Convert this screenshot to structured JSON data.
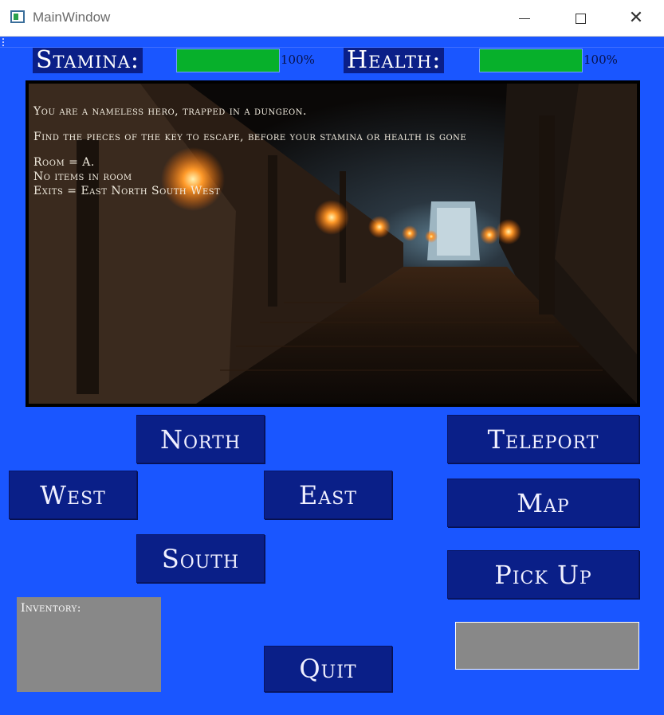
{
  "window": {
    "title": "MainWindow",
    "close_glyph": "✕"
  },
  "stats": {
    "stamina_label": "Stamina:",
    "stamina_pct": "100%",
    "stamina_value": 100,
    "health_label": "Health:",
    "health_pct": "100%",
    "health_value": 100,
    "bar_color": "#07b02b"
  },
  "scene": {
    "line1": "You are a nameless hero, trapped in a dungeon.",
    "line2": "Find the pieces of the key to escape, before your stamina or health is gone",
    "room": "Room = A.",
    "items": "No items in room",
    "exits": "Exits =  East  North  South  West"
  },
  "buttons": {
    "north": "North",
    "west": "West",
    "east": "East",
    "south": "South",
    "teleport": "Teleport",
    "map": "Map",
    "pick_up": "Pick Up",
    "quit": "Quit"
  },
  "inventory": {
    "label": "Inventory:"
  },
  "colors": {
    "background": "#1a56ff",
    "button": "#0a1f88",
    "panel": "#888888"
  }
}
